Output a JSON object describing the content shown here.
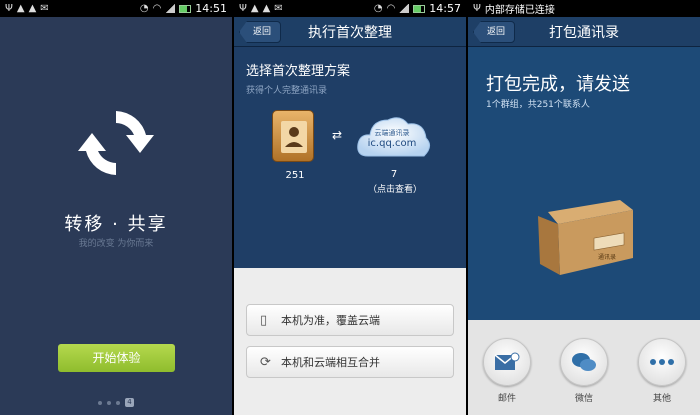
{
  "panel1": {
    "status": {
      "time": "14:51"
    },
    "brand": "转移 · 共享",
    "slogan": "我的改变  为你而来",
    "start_button": "开始体验",
    "page_indicator": {
      "current": "4"
    }
  },
  "panel2": {
    "status": {
      "time": "14:57"
    },
    "back": "返回",
    "title": "执行首次整理",
    "heading": "选择首次整理方案",
    "subheading": "获得个人完整通讯录",
    "local_count": "251",
    "cloud_label": "云端通讯录",
    "cloud_domain": "ic.qq.com",
    "cloud_count": "7",
    "cloud_hint": "（点击查看）",
    "options": [
      "本机为准，覆盖云端",
      "本机和云端相互合并"
    ]
  },
  "panel3": {
    "status": {
      "notice": "内部存储已连接"
    },
    "back": "返回",
    "title": "打包通讯录",
    "heading": "打包完成，请发送",
    "summary": "1个群组，共251个联系人",
    "box_label": "通讯录",
    "share": [
      {
        "label": "邮件",
        "icon": "mail-icon"
      },
      {
        "label": "微信",
        "icon": "wechat-icon"
      },
      {
        "label": "其他",
        "icon": "more-icon"
      }
    ]
  }
}
